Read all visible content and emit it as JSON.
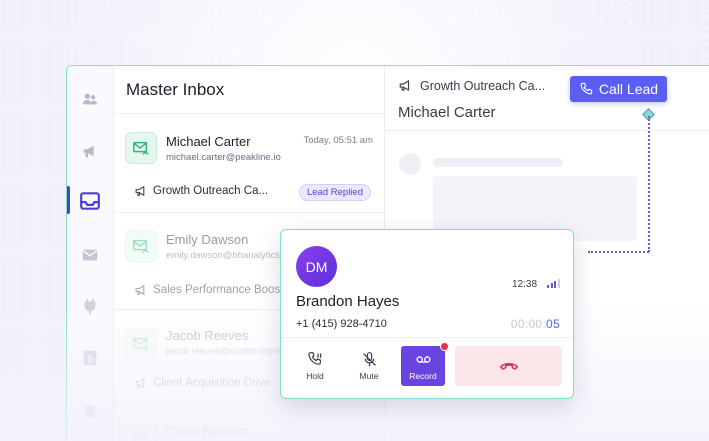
{
  "inbox": {
    "title": "Master Inbox",
    "items": [
      {
        "name": "Michael Carter",
        "email": "michael.carter@peakline.io",
        "time": "Today, 05:51 am",
        "campaign": "Growth Outreach Ca...",
        "badge": "Lead Replied"
      },
      {
        "name": "Emily Dawson",
        "email": "emily.dawson@bhanalytics.",
        "campaign": "Sales Performance Boost"
      },
      {
        "name": "Jacob Reeves",
        "email": "jacob.reeves@northbridget",
        "campaign": "Client Acquisition Drive"
      },
      {
        "name": "Olivia Bennett"
      }
    ]
  },
  "detail": {
    "campaign": "Growth Outreach Ca...",
    "name": "Michael Carter"
  },
  "call_button": {
    "label": "Call Lead"
  },
  "dialer": {
    "initials": "DM",
    "time": "12:38",
    "name": "Brandon Hayes",
    "phone": "+1 (415) 928-4710",
    "timer_dim": "00:00:",
    "timer_bright": "05",
    "controls": {
      "hold": "Hold",
      "mute": "Mute",
      "record": "Record"
    }
  },
  "icons": {
    "sidebar": [
      "contacts-icon",
      "megaphone-icon",
      "inbox-icon",
      "mail-icon",
      "plug-icon",
      "dollar-icon",
      "puzzle-icon"
    ],
    "call": "phone-icon",
    "hangup": "hangup-icon"
  },
  "colors": {
    "accent": "#5b5ef5",
    "teal_border": "#7fe0c4",
    "badge": "#5a3fd8",
    "record": "#6a44e0",
    "hangup_bg": "#fde6ea",
    "hangup": "#e0284a"
  }
}
